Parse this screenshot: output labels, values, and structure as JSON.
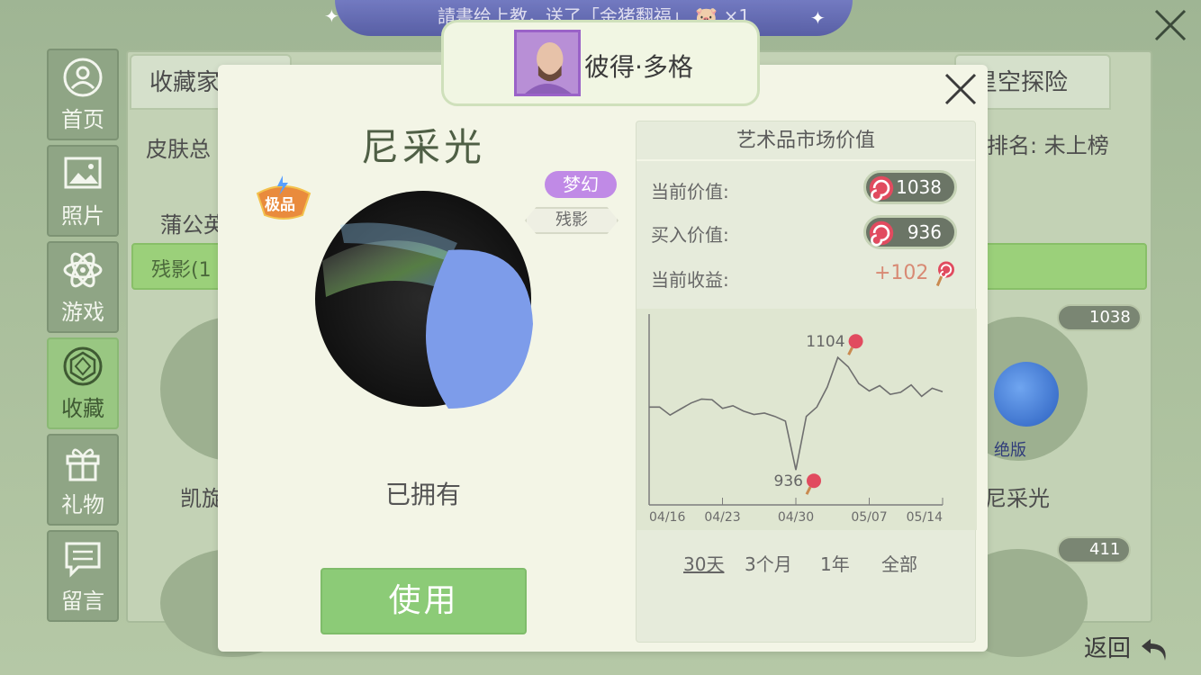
{
  "banner": {
    "text": "請書给上教，送了「金猪翻福」",
    "count": "×1"
  },
  "sidenav": {
    "items": [
      {
        "label": "首页",
        "icon": "home-icon"
      },
      {
        "label": "照片",
        "icon": "photo-icon"
      },
      {
        "label": "游戏",
        "icon": "atom-icon"
      },
      {
        "label": "收藏",
        "icon": "gem-icon",
        "active": true
      },
      {
        "label": "礼物",
        "icon": "gift-icon"
      },
      {
        "label": "留言",
        "icon": "message-icon"
      }
    ]
  },
  "background": {
    "tab_left": "收藏家",
    "tab_right": "星空探险",
    "row_left": "皮肤总",
    "row_right": "排名: 未上榜",
    "item_left": "蒲公英",
    "green_bar": "残影(1",
    "bottom_left": "凯旋",
    "right_item_name": "尼采光",
    "right_item_badge": "绝版",
    "price_1": "1038",
    "price_2": "411"
  },
  "user": {
    "name": "彼得·多格"
  },
  "item": {
    "title": "尼采光",
    "rarity": "极品",
    "tag_pill": "梦幻",
    "tag_hex": "残影",
    "status": "已拥有",
    "use_label": "使用"
  },
  "market": {
    "heading": "艺术品市场价值",
    "current_label": "当前价值:",
    "current_value": "1038",
    "buy_label": "买入价值:",
    "buy_value": "936",
    "profit_label": "当前收益:",
    "profit_value": "+102",
    "ranges": [
      "30天",
      "3个月",
      "1年",
      "全部"
    ],
    "active_range": "30天"
  },
  "chart_data": {
    "type": "line",
    "x_ticks": [
      "04/16",
      "04/23",
      "04/30",
      "05/07",
      "05/14"
    ],
    "x": [
      "04/16",
      "04/17",
      "04/18",
      "04/19",
      "04/20",
      "04/21",
      "04/22",
      "04/23",
      "04/24",
      "04/25",
      "04/26",
      "04/27",
      "04/28",
      "04/29",
      "04/30",
      "05/01",
      "05/02",
      "05/03",
      "05/04",
      "05/05",
      "05/06",
      "05/07",
      "05/08",
      "05/09",
      "05/10",
      "05/11",
      "05/12",
      "05/13",
      "05/14"
    ],
    "values": [
      1030,
      1030,
      1018,
      1027,
      1036,
      1042,
      1041,
      1028,
      1032,
      1024,
      1019,
      1021,
      1016,
      1009,
      936,
      1016,
      1030,
      1060,
      1104,
      1090,
      1065,
      1054,
      1062,
      1049,
      1052,
      1063,
      1046,
      1058,
      1053
    ],
    "annotations": [
      {
        "label": "1104"
      },
      {
        "label": "936"
      }
    ],
    "ylim": [
      900,
      1150
    ],
    "grid": false
  },
  "footer": {
    "back_label": "返回"
  },
  "colors": {
    "accent_green": "#8ccb77",
    "pill_purple": "#c08ae6",
    "gain": "#d88a74"
  }
}
